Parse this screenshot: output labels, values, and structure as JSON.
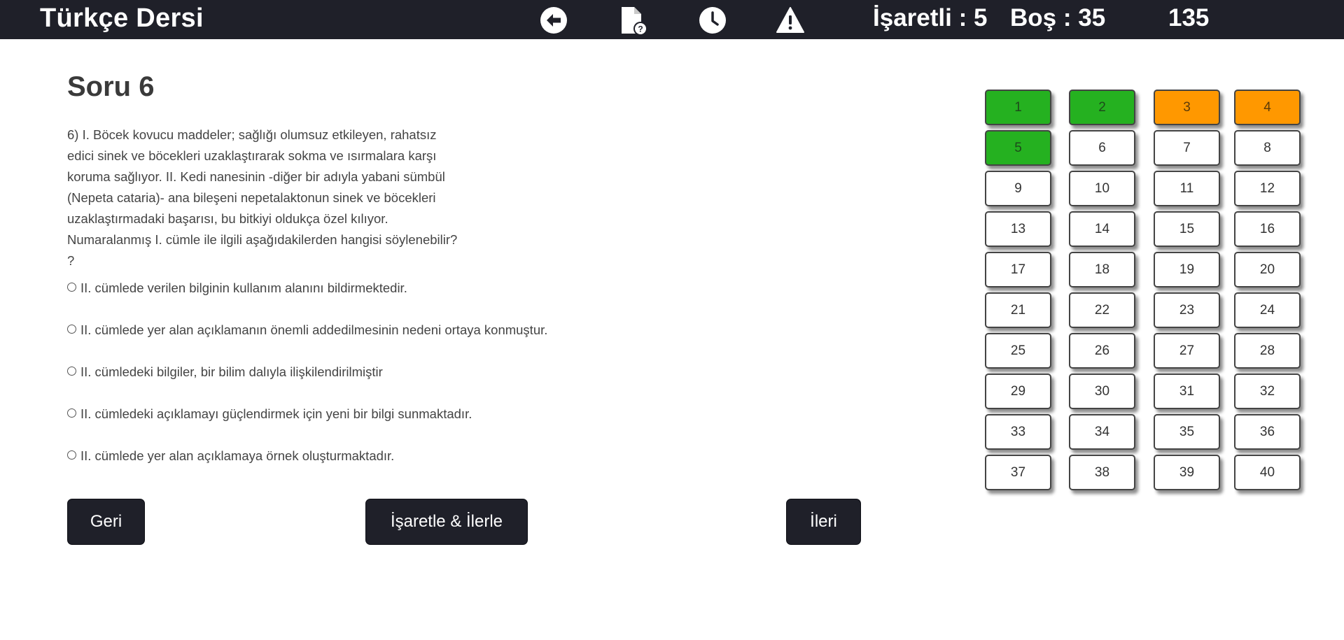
{
  "app": {
    "title": "Türkçe Dersi"
  },
  "toolbar": {
    "icons": [
      "back-arrow-icon",
      "file-question-icon",
      "clock-icon",
      "warning-icon"
    ],
    "marked_label": "İşaretli : 5",
    "empty_label": "Boş : 35",
    "timer": "135"
  },
  "question": {
    "title": "Soru 6",
    "text": "6) I. Böcek kovucu maddeler; sağlığı olumsuz etkileyen, rahatsız edici sinek ve böcekleri uzaklaştırarak sokma ve ısırmalara karşı koruma sağlıyor. II. Kedi nanesinin -diğer bir adıyla yabani sümbül (Nepeta cataria)- ana bileşeni nepetalaktonun sinek ve böcekleri uzaklaştırmadaki başarısı, bu bitkiyi oldukça özel kılıyor. Numaralanmış I. cümle ile ilgili aşağıdakilerden hangisi söylenebilir? ?",
    "options": [
      "II. cümlede verilen bilginin kullanım alanını bildirmektedir.",
      "II. cümlede yer alan açıklamanın önemli addedilmesinin nedeni ortaya konmuştur.",
      "II. cümledeki bilgiler, bir bilim dalıyla ilişkilendirilmiştir",
      "II. cümledeki açıklamayı güçlendirmek için yeni bir bilgi sunmaktadır.",
      "II. cümlede yer alan açıklamaya örnek oluşturmaktadır."
    ]
  },
  "buttons": {
    "back": "Geri",
    "mark_next": "İşaretle & İlerle",
    "next": "İleri"
  },
  "navigator": {
    "colors": {
      "answered": "#25b120",
      "marked": "#ff9800",
      "empty": "#ffffff"
    },
    "items": [
      {
        "label": "1",
        "state": "answered"
      },
      {
        "label": "2",
        "state": "answered"
      },
      {
        "label": "3",
        "state": "marked"
      },
      {
        "label": "4",
        "state": "marked"
      },
      {
        "label": "5",
        "state": "answered"
      },
      {
        "label": "6",
        "state": "empty"
      },
      {
        "label": "7",
        "state": "empty"
      },
      {
        "label": "8",
        "state": "empty"
      },
      {
        "label": "9",
        "state": "empty"
      },
      {
        "label": "10",
        "state": "empty"
      },
      {
        "label": "11",
        "state": "empty"
      },
      {
        "label": "12",
        "state": "empty"
      },
      {
        "label": "13",
        "state": "empty"
      },
      {
        "label": "14",
        "state": "empty"
      },
      {
        "label": "15",
        "state": "empty"
      },
      {
        "label": "16",
        "state": "empty"
      },
      {
        "label": "17",
        "state": "empty"
      },
      {
        "label": "18",
        "state": "empty"
      },
      {
        "label": "19",
        "state": "empty"
      },
      {
        "label": "20",
        "state": "empty"
      },
      {
        "label": "21",
        "state": "empty"
      },
      {
        "label": "22",
        "state": "empty"
      },
      {
        "label": "23",
        "state": "empty"
      },
      {
        "label": "24",
        "state": "empty"
      },
      {
        "label": "25",
        "state": "empty"
      },
      {
        "label": "26",
        "state": "empty"
      },
      {
        "label": "27",
        "state": "empty"
      },
      {
        "label": "28",
        "state": "empty"
      },
      {
        "label": "29",
        "state": "empty"
      },
      {
        "label": "30",
        "state": "empty"
      },
      {
        "label": "31",
        "state": "empty"
      },
      {
        "label": "32",
        "state": "empty"
      },
      {
        "label": "33",
        "state": "empty"
      },
      {
        "label": "34",
        "state": "empty"
      },
      {
        "label": "35",
        "state": "empty"
      },
      {
        "label": "36",
        "state": "empty"
      },
      {
        "label": "37",
        "state": "empty"
      },
      {
        "label": "38",
        "state": "empty"
      },
      {
        "label": "39",
        "state": "empty"
      },
      {
        "label": "40",
        "state": "empty"
      }
    ]
  }
}
